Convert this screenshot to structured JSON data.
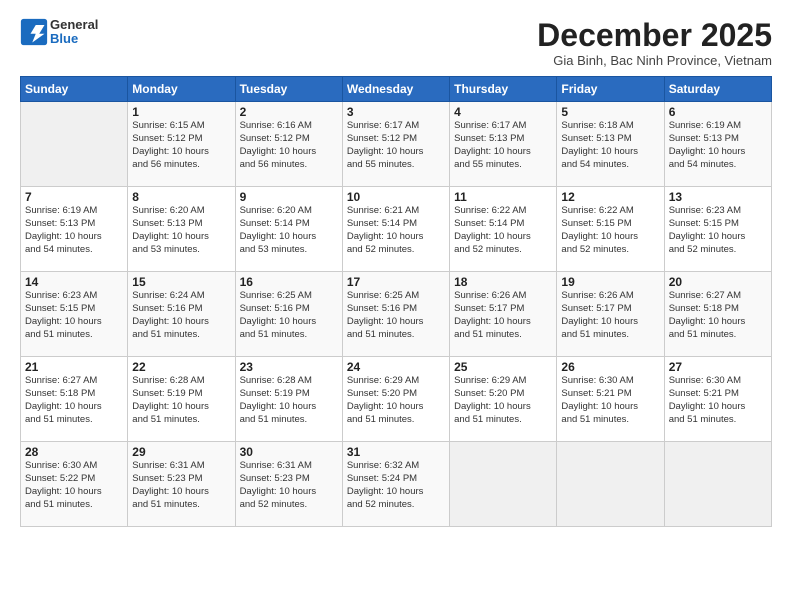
{
  "logo": {
    "general": "General",
    "blue": "Blue"
  },
  "header": {
    "title": "December 2025",
    "subtitle": "Gia Binh, Bac Ninh Province, Vietnam"
  },
  "weekdays": [
    "Sunday",
    "Monday",
    "Tuesday",
    "Wednesday",
    "Thursday",
    "Friday",
    "Saturday"
  ],
  "weeks": [
    [
      {
        "day": "",
        "info": ""
      },
      {
        "day": "1",
        "info": "Sunrise: 6:15 AM\nSunset: 5:12 PM\nDaylight: 10 hours\nand 56 minutes."
      },
      {
        "day": "2",
        "info": "Sunrise: 6:16 AM\nSunset: 5:12 PM\nDaylight: 10 hours\nand 56 minutes."
      },
      {
        "day": "3",
        "info": "Sunrise: 6:17 AM\nSunset: 5:12 PM\nDaylight: 10 hours\nand 55 minutes."
      },
      {
        "day": "4",
        "info": "Sunrise: 6:17 AM\nSunset: 5:13 PM\nDaylight: 10 hours\nand 55 minutes."
      },
      {
        "day": "5",
        "info": "Sunrise: 6:18 AM\nSunset: 5:13 PM\nDaylight: 10 hours\nand 54 minutes."
      },
      {
        "day": "6",
        "info": "Sunrise: 6:19 AM\nSunset: 5:13 PM\nDaylight: 10 hours\nand 54 minutes."
      }
    ],
    [
      {
        "day": "7",
        "info": "Sunrise: 6:19 AM\nSunset: 5:13 PM\nDaylight: 10 hours\nand 54 minutes."
      },
      {
        "day": "8",
        "info": "Sunrise: 6:20 AM\nSunset: 5:13 PM\nDaylight: 10 hours\nand 53 minutes."
      },
      {
        "day": "9",
        "info": "Sunrise: 6:20 AM\nSunset: 5:14 PM\nDaylight: 10 hours\nand 53 minutes."
      },
      {
        "day": "10",
        "info": "Sunrise: 6:21 AM\nSunset: 5:14 PM\nDaylight: 10 hours\nand 52 minutes."
      },
      {
        "day": "11",
        "info": "Sunrise: 6:22 AM\nSunset: 5:14 PM\nDaylight: 10 hours\nand 52 minutes."
      },
      {
        "day": "12",
        "info": "Sunrise: 6:22 AM\nSunset: 5:15 PM\nDaylight: 10 hours\nand 52 minutes."
      },
      {
        "day": "13",
        "info": "Sunrise: 6:23 AM\nSunset: 5:15 PM\nDaylight: 10 hours\nand 52 minutes."
      }
    ],
    [
      {
        "day": "14",
        "info": "Sunrise: 6:23 AM\nSunset: 5:15 PM\nDaylight: 10 hours\nand 51 minutes."
      },
      {
        "day": "15",
        "info": "Sunrise: 6:24 AM\nSunset: 5:16 PM\nDaylight: 10 hours\nand 51 minutes."
      },
      {
        "day": "16",
        "info": "Sunrise: 6:25 AM\nSunset: 5:16 PM\nDaylight: 10 hours\nand 51 minutes."
      },
      {
        "day": "17",
        "info": "Sunrise: 6:25 AM\nSunset: 5:16 PM\nDaylight: 10 hours\nand 51 minutes."
      },
      {
        "day": "18",
        "info": "Sunrise: 6:26 AM\nSunset: 5:17 PM\nDaylight: 10 hours\nand 51 minutes."
      },
      {
        "day": "19",
        "info": "Sunrise: 6:26 AM\nSunset: 5:17 PM\nDaylight: 10 hours\nand 51 minutes."
      },
      {
        "day": "20",
        "info": "Sunrise: 6:27 AM\nSunset: 5:18 PM\nDaylight: 10 hours\nand 51 minutes."
      }
    ],
    [
      {
        "day": "21",
        "info": "Sunrise: 6:27 AM\nSunset: 5:18 PM\nDaylight: 10 hours\nand 51 minutes."
      },
      {
        "day": "22",
        "info": "Sunrise: 6:28 AM\nSunset: 5:19 PM\nDaylight: 10 hours\nand 51 minutes."
      },
      {
        "day": "23",
        "info": "Sunrise: 6:28 AM\nSunset: 5:19 PM\nDaylight: 10 hours\nand 51 minutes."
      },
      {
        "day": "24",
        "info": "Sunrise: 6:29 AM\nSunset: 5:20 PM\nDaylight: 10 hours\nand 51 minutes."
      },
      {
        "day": "25",
        "info": "Sunrise: 6:29 AM\nSunset: 5:20 PM\nDaylight: 10 hours\nand 51 minutes."
      },
      {
        "day": "26",
        "info": "Sunrise: 6:30 AM\nSunset: 5:21 PM\nDaylight: 10 hours\nand 51 minutes."
      },
      {
        "day": "27",
        "info": "Sunrise: 6:30 AM\nSunset: 5:21 PM\nDaylight: 10 hours\nand 51 minutes."
      }
    ],
    [
      {
        "day": "28",
        "info": "Sunrise: 6:30 AM\nSunset: 5:22 PM\nDaylight: 10 hours\nand 51 minutes."
      },
      {
        "day": "29",
        "info": "Sunrise: 6:31 AM\nSunset: 5:23 PM\nDaylight: 10 hours\nand 51 minutes."
      },
      {
        "day": "30",
        "info": "Sunrise: 6:31 AM\nSunset: 5:23 PM\nDaylight: 10 hours\nand 52 minutes."
      },
      {
        "day": "31",
        "info": "Sunrise: 6:32 AM\nSunset: 5:24 PM\nDaylight: 10 hours\nand 52 minutes."
      },
      {
        "day": "",
        "info": ""
      },
      {
        "day": "",
        "info": ""
      },
      {
        "day": "",
        "info": ""
      }
    ]
  ]
}
